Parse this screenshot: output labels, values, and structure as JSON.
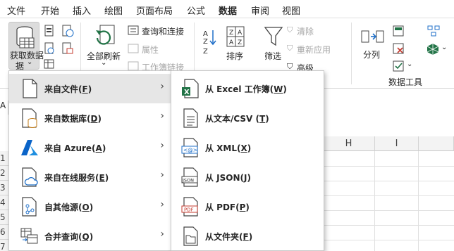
{
  "tabs": [
    "文件",
    "开始",
    "插入",
    "绘图",
    "页面布局",
    "公式",
    "数据",
    "审阅",
    "视图"
  ],
  "active_tab": "数据",
  "ribbon": {
    "get_data": "获取数据",
    "get_data_sub": "据",
    "refresh_all": "全部刷新",
    "queries_connections": "查询和连接",
    "properties": "属性",
    "workbook_links": "工作簿链接",
    "sort": "排序",
    "filter": "筛选",
    "clear": "清除",
    "reapply": "重新应用",
    "advanced": "高级",
    "split": "分列",
    "data_tools": "数据工具"
  },
  "sheet": {
    "namebox": "A",
    "col_headers": [
      "H",
      "I"
    ],
    "row_headers": [
      "1",
      "2",
      "3",
      "4",
      "5",
      "6",
      "7"
    ]
  },
  "menu_main": [
    {
      "label": "来自文件(",
      "key": "F",
      "tail": ")",
      "icon": "file-icon",
      "arrow": "›"
    },
    {
      "label": "来自数据库(",
      "key": "D",
      "tail": ")",
      "icon": "database-icon",
      "arrow": "›"
    },
    {
      "label": "来自 Azure(",
      "key": "A",
      "tail": ")",
      "icon": "azure-icon",
      "arrow": "›"
    },
    {
      "label": "来自在线服务(",
      "key": "E",
      "tail": ")",
      "icon": "online-service-icon",
      "arrow": "›"
    },
    {
      "label": "自其他源(",
      "key": "O",
      "tail": ")",
      "icon": "other-sources-icon",
      "arrow": "›"
    },
    {
      "label": "合并查询(",
      "key": "Q",
      "tail": ")",
      "icon": "combine-queries-icon",
      "arrow": "›"
    }
  ],
  "menu_file": [
    {
      "label": "从 Excel 工作簿(",
      "key": "W",
      "tail": ")",
      "icon": "excel-workbook-icon",
      "badge": "X"
    },
    {
      "label": "从文本/CSV (",
      "key": "T",
      "tail": ")",
      "icon": "text-csv-icon",
      "badge": ""
    },
    {
      "label": "从 XML(",
      "key": "X",
      "tail": ")",
      "icon": "xml-icon",
      "badge": "<@>"
    },
    {
      "label": "从 JSON(",
      "key": "J",
      "tail": ")",
      "icon": "json-icon",
      "badge": "JSON"
    },
    {
      "label": "从 PDF(",
      "key": "P",
      "tail": ")",
      "icon": "pdf-icon",
      "badge": "PDF"
    },
    {
      "label": "从文件夹(",
      "key": "F",
      "tail": ")",
      "icon": "folder-icon",
      "badge": ""
    }
  ],
  "colors": {
    "excel_green": "#217346",
    "highlight_border": "#1f6fc8",
    "azure_blue": "#0a64c8",
    "pdf_red": "#c43b2f"
  }
}
